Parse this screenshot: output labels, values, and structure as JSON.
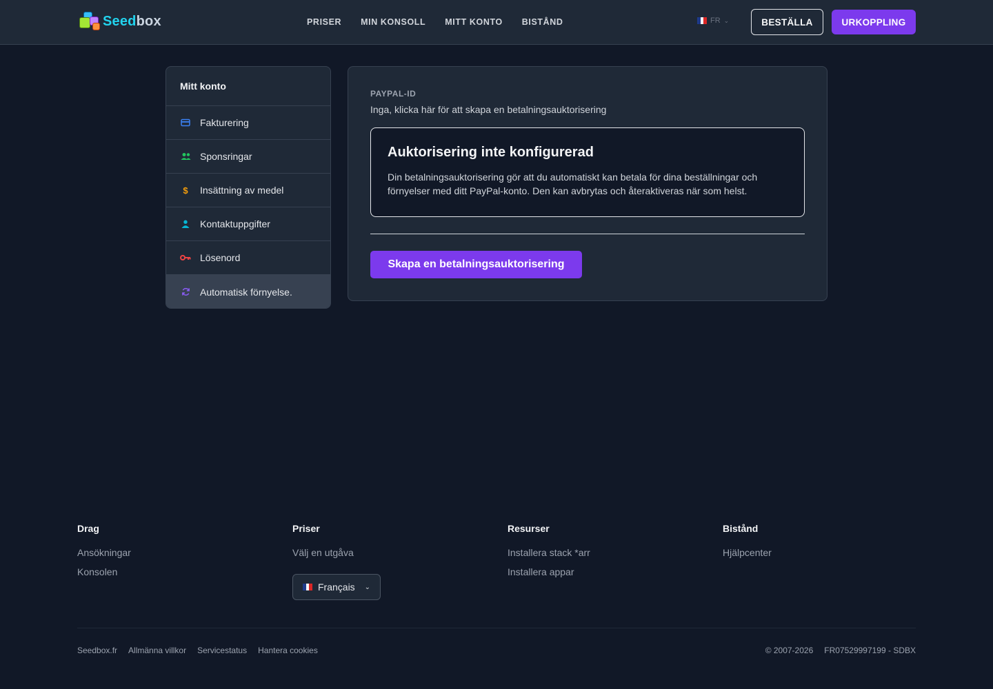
{
  "header": {
    "logo": {
      "part1": "Seed",
      "part2": "box"
    },
    "nav": [
      "PRISER",
      "MIN KONSOLL",
      "MITT KONTO",
      "BISTÅND"
    ],
    "language": "FR",
    "order_button": "BESTÄLLA",
    "logout_button": "URKOPPLING"
  },
  "sidebar": {
    "title": "Mitt konto",
    "items": [
      {
        "label": "Fakturering",
        "icon": "credit-card-icon",
        "color": "#3b82f6"
      },
      {
        "label": "Sponsringar",
        "icon": "users-icon",
        "color": "#22c55e"
      },
      {
        "label": "Insättning av medel",
        "icon": "dollar-icon",
        "color": "#f59e0b"
      },
      {
        "label": "Kontaktuppgifter",
        "icon": "user-icon",
        "color": "#06b6d4"
      },
      {
        "label": "Lösenord",
        "icon": "key-icon",
        "color": "#ef4444"
      },
      {
        "label": "Automatisk förnyelse.",
        "icon": "refresh-icon",
        "color": "#8b5cf6",
        "active": true
      }
    ]
  },
  "main": {
    "paypal_label": "PAYPAL-ID",
    "paypal_value": "Inga, klicka här för att skapa en betalningsauktorisering",
    "notice_title": "Auktorisering inte konfigurerad",
    "notice_text": "Din betalningsauktorisering gör att du automatiskt kan betala för dina beställningar och förnyelser med ditt PayPal-konto. Den kan avbrytas och återaktiveras när som helst.",
    "create_button": "Skapa en betalningsauktorisering"
  },
  "footer": {
    "columns": [
      {
        "title": "Drag",
        "links": [
          "Ansökningar",
          "Konsolen"
        ]
      },
      {
        "title": "Priser",
        "links": [
          "Välj en utgåva"
        ]
      },
      {
        "title": "Resurser",
        "links": [
          "Installera stack *arr",
          "Installera appar"
        ]
      },
      {
        "title": "Bistånd",
        "links": [
          "Hjälpcenter"
        ]
      }
    ],
    "language_select": "Français",
    "bottom_links": [
      "Seedbox.fr",
      "Allmänna villkor",
      "Servicestatus",
      "Hantera cookies"
    ],
    "copyright": "© 2007-2026",
    "company_id": "FR07529997199 - SDBX"
  },
  "colors": {
    "accent": "#7c3aed",
    "background": "#111827",
    "surface": "#1f2937"
  }
}
